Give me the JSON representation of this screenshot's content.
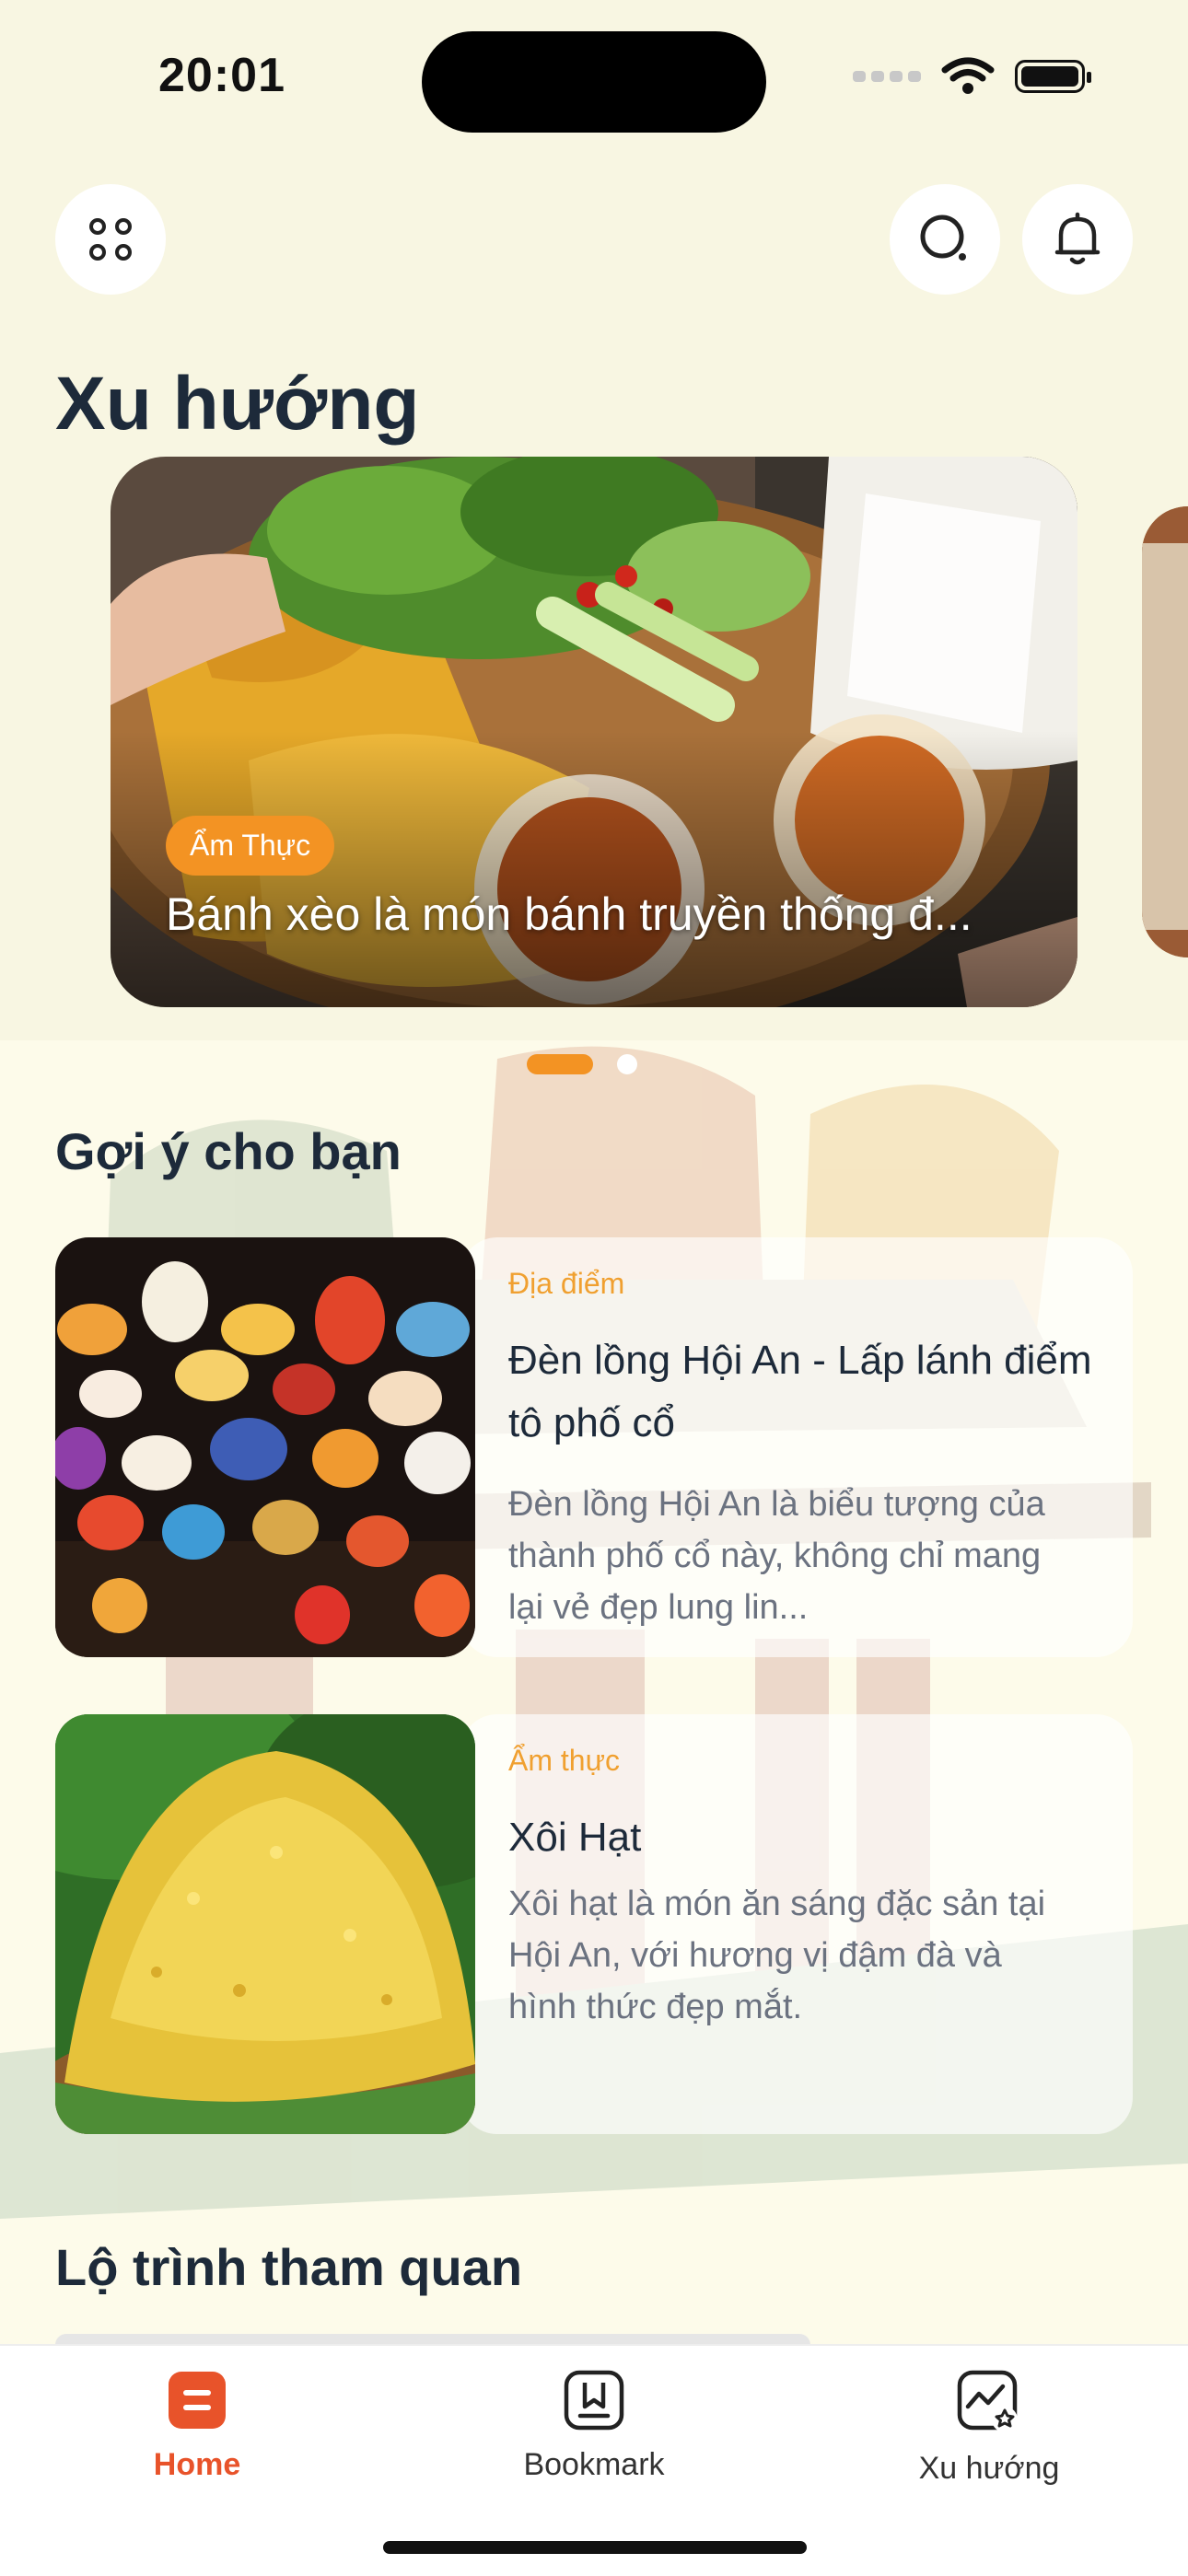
{
  "status_bar": {
    "time": "20:01"
  },
  "header": {
    "menu_icon": "grid-dots-icon",
    "search_icon": "search-icon",
    "notification_icon": "bell-icon"
  },
  "trending": {
    "title": "Xu hướng",
    "items": [
      {
        "tag": "Ẩm Thực",
        "text": "Bánh xèo là món bánh truyền thống đ..."
      }
    ],
    "active_page": 1,
    "total_pages": 2
  },
  "suggestions": {
    "title": "Gợi ý cho bạn",
    "items": [
      {
        "tag": "Địa điểm",
        "title": "Đèn lồng Hội An - Lấp lánh điểm tô phố cổ",
        "description": "Đèn lồng Hội An là biểu tượng của thành phố cổ này, không chỉ mang lại vẻ đẹp lung lin..."
      },
      {
        "tag": "Ẩm thực",
        "title": "Xôi Hạt",
        "description": "Xôi hạt là món ăn sáng đặc sản tại Hội An, với hương vị đậm đà và hình thức đẹp mắt."
      }
    ]
  },
  "tour_routes": {
    "title": "Lộ trình tham quan"
  },
  "tab_bar": {
    "items": [
      {
        "label": "Home",
        "icon": "home-icon",
        "active": true
      },
      {
        "label": "Bookmark",
        "icon": "bookmark-icon",
        "active": false
      },
      {
        "label": "Xu hướng",
        "icon": "trending-icon",
        "active": false
      }
    ]
  },
  "colors": {
    "accent": "#f39323",
    "active_tab": "#e8532a",
    "background": "#f8f6e2"
  }
}
